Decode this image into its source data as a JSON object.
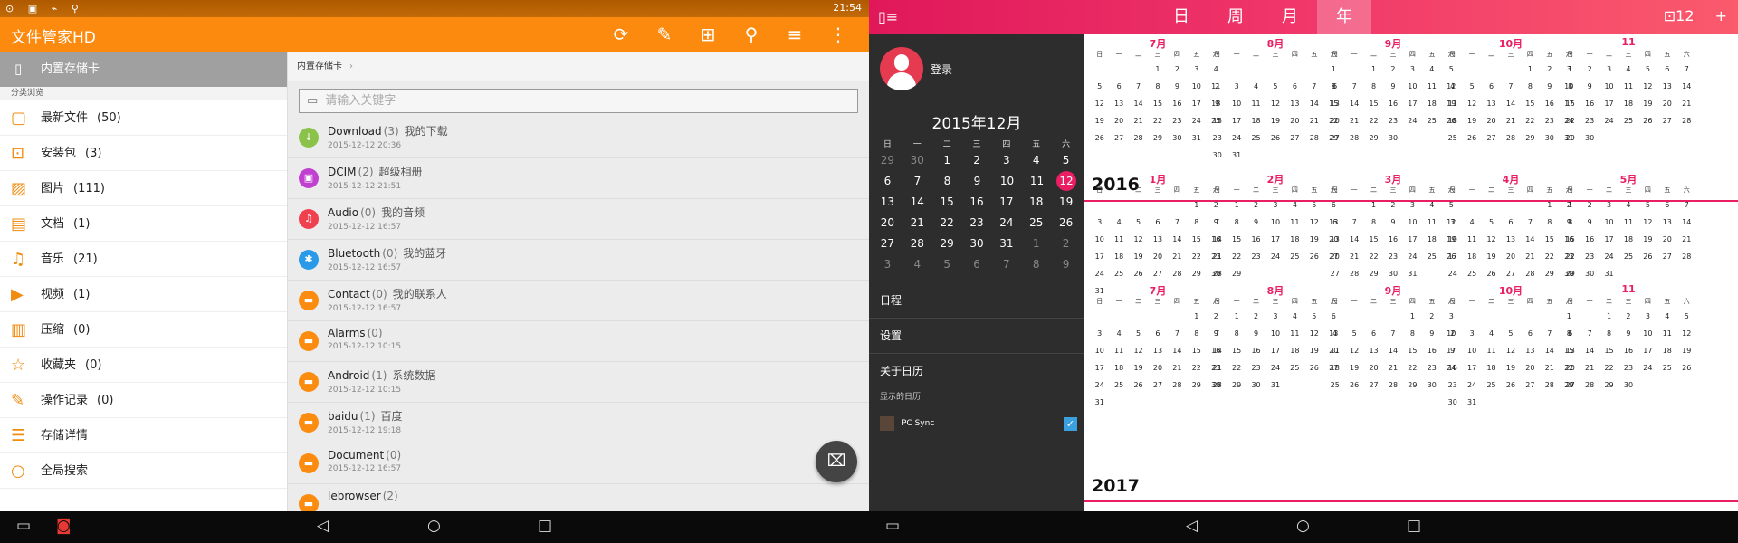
{
  "status_bar": {
    "time": "21:54",
    "left_icons": "⊙ ▣ ⌁ ⚲"
  },
  "file_manager": {
    "app_title": "文件管家HD",
    "toolbar_icons": [
      "refresh-icon",
      "edit-icon",
      "new-folder-icon",
      "filter-icon",
      "sort-icon",
      "more-icon"
    ],
    "toolbar_glyphs": [
      "⟳",
      "✎",
      "⊞",
      "⚲",
      "≡",
      "⋮"
    ],
    "storage_label": "内置存储卡",
    "section_header": "分类浏览",
    "categories": [
      {
        "label": "最新文件",
        "count": "(50)",
        "icon": "recent-icon",
        "glyph": "▢"
      },
      {
        "label": "安装包",
        "count": "(3)",
        "icon": "package-icon",
        "glyph": "⊡"
      },
      {
        "label": "图片",
        "count": "(111)",
        "icon": "image-icon",
        "glyph": "▨"
      },
      {
        "label": "文档",
        "count": "(1)",
        "icon": "document-icon",
        "glyph": "▤"
      },
      {
        "label": "音乐",
        "count": "(21)",
        "icon": "music-icon",
        "glyph": "♫"
      },
      {
        "label": "视频",
        "count": "(1)",
        "icon": "video-icon",
        "glyph": "▶"
      },
      {
        "label": "压缩",
        "count": "(0)",
        "icon": "archive-icon",
        "glyph": "▥"
      },
      {
        "label": "收藏夹",
        "count": "(0)",
        "icon": "star-icon",
        "glyph": "☆"
      },
      {
        "label": "操作记录",
        "count": "(0)",
        "icon": "history-icon",
        "glyph": "✎"
      },
      {
        "label": "存储详情",
        "count": "",
        "icon": "storage-detail-icon",
        "glyph": "☰"
      },
      {
        "label": "全局搜索",
        "count": "",
        "icon": "search-icon",
        "glyph": "○"
      }
    ],
    "breadcrumb": "内置存储卡",
    "search_placeholder": "请输入关键字",
    "files": [
      {
        "name": "Download",
        "count": "(3)",
        "alias": "我的下载",
        "date": "2015-12-12 20:36",
        "color": "#8bc34a",
        "glyph": "↓"
      },
      {
        "name": "DCIM",
        "count": "(2)",
        "alias": "超级相册",
        "date": "2015-12-12 21:51",
        "color": "#c040d0",
        "glyph": "▣"
      },
      {
        "name": "Audio",
        "count": "(0)",
        "alias": "我的音频",
        "date": "2015-12-12 16:57",
        "color": "#f04050",
        "glyph": "♫"
      },
      {
        "name": "Bluetooth",
        "count": "(0)",
        "alias": "我的蓝牙",
        "date": "2015-12-12 16:57",
        "color": "#2a9ae8",
        "glyph": "✱"
      },
      {
        "name": "Contact",
        "count": "(0)",
        "alias": "我的联系人",
        "date": "2015-12-12 16:57",
        "color": "#fb8c10",
        "glyph": "▬"
      },
      {
        "name": "Alarms",
        "count": "(0)",
        "alias": "",
        "date": "2015-12-12 10:15",
        "color": "#fb8c10",
        "glyph": "▬"
      },
      {
        "name": "Android",
        "count": "(1)",
        "alias": "系统数据",
        "date": "2015-12-12 10:15",
        "color": "#fb8c10",
        "glyph": "▬"
      },
      {
        "name": "baidu",
        "count": "(1)",
        "alias": "百度",
        "date": "2015-12-12 19:18",
        "color": "#fb8c10",
        "glyph": "▬"
      },
      {
        "name": "Document",
        "count": "(0)",
        "alias": "",
        "date": "2015-12-12 16:57",
        "color": "#fb8c10",
        "glyph": "▬"
      },
      {
        "name": "lebrowser",
        "count": "(2)",
        "alias": "",
        "date": "",
        "color": "#fb8c10",
        "glyph": "▬"
      }
    ],
    "fab_glyph": "⌧"
  },
  "nav": {
    "left": {
      "multiwin": "▭",
      "app": "◙",
      "back": "◁",
      "home": "○",
      "recent": "□"
    },
    "right": {
      "multiwin": "▭",
      "back": "◁",
      "home": "○",
      "recent": "□"
    }
  },
  "calendar": {
    "menu_glyph": "▯≡",
    "tabs": [
      "日",
      "周",
      "月",
      "年"
    ],
    "selected_tab": "年",
    "today_icon": "⊡12",
    "add_icon": "+",
    "login": "登录",
    "mini_title": "2015年12月",
    "weekdays": [
      "日",
      "一",
      "二",
      "三",
      "四",
      "五",
      "六"
    ],
    "mini_rows": [
      [
        "29",
        "30",
        "1",
        "2",
        "3",
        "4",
        "5"
      ],
      [
        "6",
        "7",
        "8",
        "9",
        "10",
        "11",
        "12"
      ],
      [
        "13",
        "14",
        "15",
        "16",
        "17",
        "18",
        "19"
      ],
      [
        "20",
        "21",
        "22",
        "23",
        "24",
        "25",
        "26"
      ],
      [
        "27",
        "28",
        "29",
        "30",
        "31",
        "1",
        "2"
      ],
      [
        "3",
        "4",
        "5",
        "6",
        "7",
        "8",
        "9"
      ]
    ],
    "today": "12",
    "menu": [
      "日程",
      "设置",
      "关于日历"
    ],
    "shown_calendars_label": "显示的日历",
    "pc_sync": "PC Sync",
    "years": [
      "2016",
      "2017"
    ],
    "year_months": [
      {
        "label": "7月",
        "rows": [
          [
            "",
            "",
            "",
            "1",
            "2",
            "3",
            "4"
          ],
          [
            "5",
            "6",
            "7",
            "8",
            "9",
            "10",
            "11"
          ],
          [
            "12",
            "13",
            "14",
            "15",
            "16",
            "17",
            "18"
          ],
          [
            "19",
            "20",
            "21",
            "22",
            "23",
            "24",
            "25"
          ],
          [
            "26",
            "27",
            "28",
            "29",
            "30",
            "31",
            ""
          ]
        ]
      },
      {
        "label": "8月",
        "rows": [
          [
            "",
            "",
            "",
            "",
            "",
            "",
            "1"
          ],
          [
            "2",
            "3",
            "4",
            "5",
            "6",
            "7",
            "8"
          ],
          [
            "9",
            "10",
            "11",
            "12",
            "13",
            "14",
            "15"
          ],
          [
            "16",
            "17",
            "18",
            "19",
            "20",
            "21",
            "22"
          ],
          [
            "23",
            "24",
            "25",
            "26",
            "27",
            "28",
            "29"
          ],
          [
            "30",
            "31",
            "",
            "",
            "",
            "",
            ""
          ]
        ]
      },
      {
        "label": "9月",
        "rows": [
          [
            "",
            "",
            "1",
            "2",
            "3",
            "4",
            "5"
          ],
          [
            "6",
            "7",
            "8",
            "9",
            "10",
            "11",
            "12"
          ],
          [
            "13",
            "14",
            "15",
            "16",
            "17",
            "18",
            "19"
          ],
          [
            "20",
            "21",
            "22",
            "23",
            "24",
            "25",
            "26"
          ],
          [
            "27",
            "28",
            "29",
            "30",
            "",
            "",
            ""
          ]
        ]
      },
      {
        "label": "10月",
        "rows": [
          [
            "",
            "",
            "",
            "",
            "1",
            "2",
            "3"
          ],
          [
            "4",
            "5",
            "6",
            "7",
            "8",
            "9",
            "10"
          ],
          [
            "11",
            "12",
            "13",
            "14",
            "15",
            "16",
            "17"
          ],
          [
            "18",
            "19",
            "20",
            "21",
            "22",
            "23",
            "24"
          ],
          [
            "25",
            "26",
            "27",
            "28",
            "29",
            "30",
            "31"
          ]
        ]
      },
      {
        "label": "11",
        "rows": [
          [
            "1",
            "2",
            "3",
            "4",
            "5",
            "6",
            "7"
          ],
          [
            "8",
            "9",
            "10",
            "11",
            "12",
            "13",
            "14"
          ],
          [
            "15",
            "16",
            "17",
            "18",
            "19",
            "20",
            "21"
          ],
          [
            "22",
            "23",
            "24",
            "25",
            "26",
            "27",
            "28"
          ],
          [
            "29",
            "30",
            "",
            "",
            "",
            "",
            ""
          ]
        ]
      },
      {
        "label": "1月",
        "rows": [
          [
            "",
            "",
            "",
            "",
            "",
            "1",
            "2"
          ],
          [
            "3",
            "4",
            "5",
            "6",
            "7",
            "8",
            "9"
          ],
          [
            "10",
            "11",
            "12",
            "13",
            "14",
            "15",
            "16"
          ],
          [
            "17",
            "18",
            "19",
            "20",
            "21",
            "22",
            "23"
          ],
          [
            "24",
            "25",
            "26",
            "27",
            "28",
            "29",
            "30"
          ],
          [
            "31",
            "",
            "",
            "",
            "",
            "",
            ""
          ]
        ]
      },
      {
        "label": "2月",
        "rows": [
          [
            "",
            "1",
            "2",
            "3",
            "4",
            "5",
            "6"
          ],
          [
            "7",
            "8",
            "9",
            "10",
            "11",
            "12",
            "13"
          ],
          [
            "14",
            "15",
            "16",
            "17",
            "18",
            "19",
            "20"
          ],
          [
            "21",
            "22",
            "23",
            "24",
            "25",
            "26",
            "27"
          ],
          [
            "28",
            "29",
            "",
            "",
            "",
            "",
            ""
          ]
        ]
      },
      {
        "label": "3月",
        "rows": [
          [
            "",
            "",
            "1",
            "2",
            "3",
            "4",
            "5"
          ],
          [
            "6",
            "7",
            "8",
            "9",
            "10",
            "11",
            "12"
          ],
          [
            "13",
            "14",
            "15",
            "16",
            "17",
            "18",
            "19"
          ],
          [
            "20",
            "21",
            "22",
            "23",
            "24",
            "25",
            "26"
          ],
          [
            "27",
            "28",
            "29",
            "30",
            "31",
            "",
            ""
          ]
        ]
      },
      {
        "label": "4月",
        "rows": [
          [
            "",
            "",
            "",
            "",
            "",
            "1",
            "2"
          ],
          [
            "3",
            "4",
            "5",
            "6",
            "7",
            "8",
            "9"
          ],
          [
            "10",
            "11",
            "12",
            "13",
            "14",
            "15",
            "16"
          ],
          [
            "17",
            "18",
            "19",
            "20",
            "21",
            "22",
            "23"
          ],
          [
            "24",
            "25",
            "26",
            "27",
            "28",
            "29",
            "30"
          ]
        ]
      },
      {
        "label": "5月",
        "rows": [
          [
            "1",
            "2",
            "3",
            "4",
            "5",
            "6",
            "7"
          ],
          [
            "8",
            "9",
            "10",
            "11",
            "12",
            "13",
            "14"
          ],
          [
            "15",
            "16",
            "17",
            "18",
            "19",
            "20",
            "21"
          ],
          [
            "22",
            "23",
            "24",
            "25",
            "26",
            "27",
            "28"
          ],
          [
            "29",
            "30",
            "31",
            "",
            "",
            "",
            ""
          ]
        ]
      },
      {
        "label": "7月",
        "rows": [
          [
            "",
            "",
            "",
            "",
            "",
            "1",
            "2"
          ],
          [
            "3",
            "4",
            "5",
            "6",
            "7",
            "8",
            "9"
          ],
          [
            "10",
            "11",
            "12",
            "13",
            "14",
            "15",
            "16"
          ],
          [
            "17",
            "18",
            "19",
            "20",
            "21",
            "22",
            "23"
          ],
          [
            "24",
            "25",
            "26",
            "27",
            "28",
            "29",
            "30"
          ],
          [
            "31",
            "",
            "",
            "",
            "",
            "",
            ""
          ]
        ]
      },
      {
        "label": "8月",
        "rows": [
          [
            "",
            "1",
            "2",
            "3",
            "4",
            "5",
            "6"
          ],
          [
            "7",
            "8",
            "9",
            "10",
            "11",
            "12",
            "13"
          ],
          [
            "14",
            "15",
            "16",
            "17",
            "18",
            "19",
            "20"
          ],
          [
            "21",
            "22",
            "23",
            "24",
            "25",
            "26",
            "27"
          ],
          [
            "28",
            "29",
            "30",
            "31",
            "",
            "",
            ""
          ]
        ]
      },
      {
        "label": "9月",
        "rows": [
          [
            "",
            "",
            "",
            "",
            "1",
            "2",
            "3"
          ],
          [
            "4",
            "5",
            "6",
            "7",
            "8",
            "9",
            "10"
          ],
          [
            "11",
            "12",
            "13",
            "14",
            "15",
            "16",
            "17"
          ],
          [
            "18",
            "19",
            "20",
            "21",
            "22",
            "23",
            "24"
          ],
          [
            "25",
            "26",
            "27",
            "28",
            "29",
            "30",
            ""
          ]
        ]
      },
      {
        "label": "10月",
        "rows": [
          [
            "",
            "",
            "",
            "",
            "",
            "",
            "1"
          ],
          [
            "2",
            "3",
            "4",
            "5",
            "6",
            "7",
            "8"
          ],
          [
            "9",
            "10",
            "11",
            "12",
            "13",
            "14",
            "15"
          ],
          [
            "16",
            "17",
            "18",
            "19",
            "20",
            "21",
            "22"
          ],
          [
            "23",
            "24",
            "25",
            "26",
            "27",
            "28",
            "29"
          ],
          [
            "30",
            "31",
            "",
            "",
            "",
            "",
            ""
          ]
        ]
      },
      {
        "label": "11",
        "rows": [
          [
            "",
            "",
            "1",
            "2",
            "3",
            "4",
            "5"
          ],
          [
            "6",
            "7",
            "8",
            "9",
            "10",
            "11",
            "12"
          ],
          [
            "13",
            "14",
            "15",
            "16",
            "17",
            "18",
            "19"
          ],
          [
            "20",
            "21",
            "22",
            "23",
            "24",
            "25",
            "26"
          ],
          [
            "27",
            "28",
            "29",
            "30",
            "",
            "",
            ""
          ]
        ]
      }
    ]
  },
  "colors": {
    "file_accent": "#fc8a0e",
    "calendar_accent": "#e91e63"
  }
}
